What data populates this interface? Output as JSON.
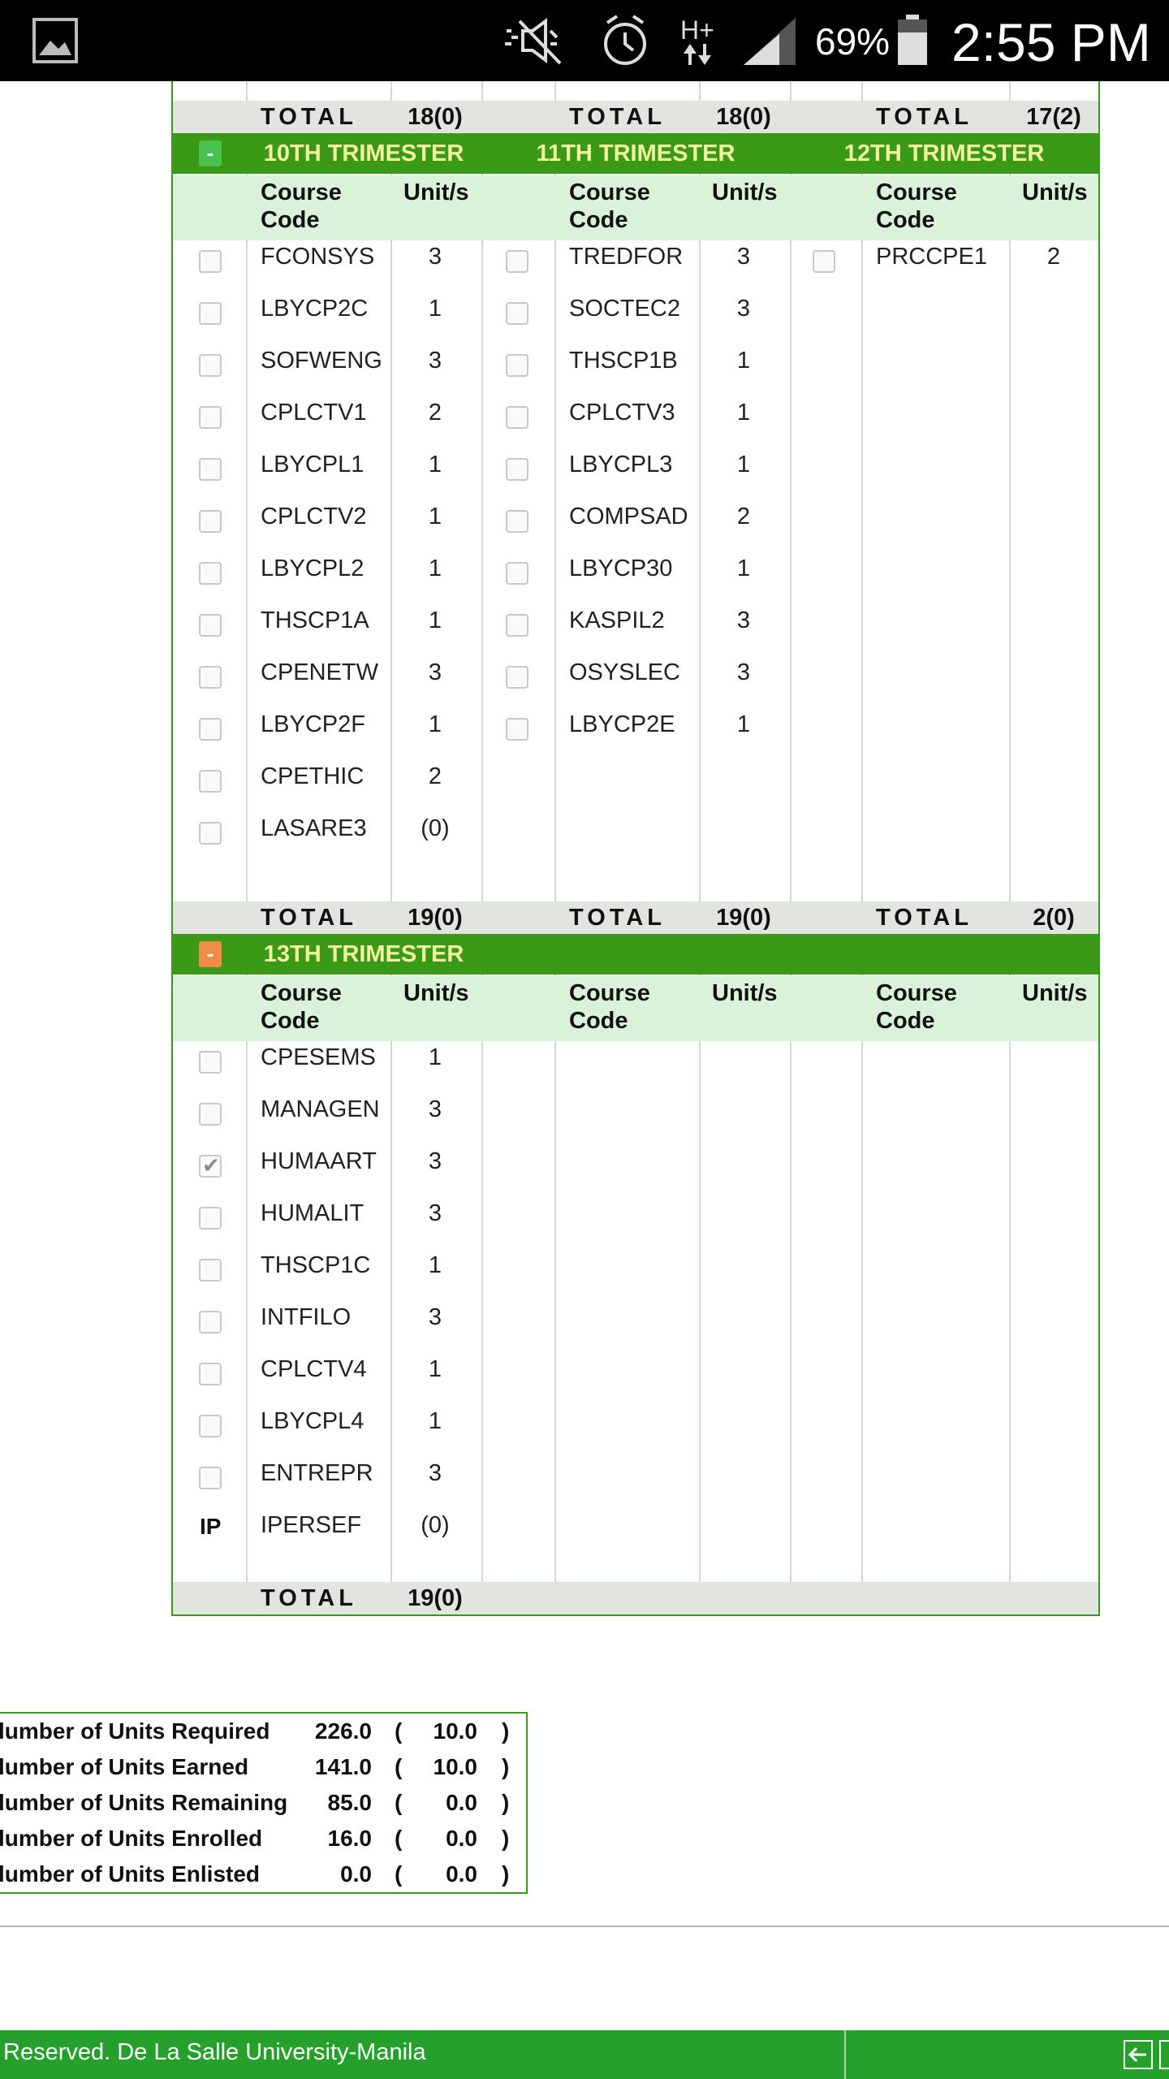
{
  "status_bar": {
    "battery_percent": "69%",
    "time": "2:55 PM",
    "icons": [
      "gallery-icon",
      "mute-icon",
      "alarm-icon",
      "hplus-data-icon",
      "signal-icon",
      "battery-icon"
    ]
  },
  "curriculum": {
    "headers": {
      "course_code": "Course\nCode",
      "units": "Unit/s"
    },
    "total_label": "TOTAL",
    "top_totals": [
      "18(0)",
      "18(0)",
      "17(2)"
    ],
    "block1": {
      "toggle": "-",
      "titles": [
        "10TH TRIMESTER",
        "11TH TRIMESTER",
        "12TH TRIMESTER"
      ],
      "col1": [
        {
          "code": "FCONSYS",
          "units": "3"
        },
        {
          "code": "LBYCP2C",
          "units": "1"
        },
        {
          "code": "SOFWENG",
          "units": "3"
        },
        {
          "code": "CPLCTV1",
          "units": "2"
        },
        {
          "code": "LBYCPL1",
          "units": "1"
        },
        {
          "code": "CPLCTV2",
          "units": "1"
        },
        {
          "code": "LBYCPL2",
          "units": "1"
        },
        {
          "code": "THSCP1A",
          "units": "1"
        },
        {
          "code": "CPENETW",
          "units": "3"
        },
        {
          "code": "LBYCP2F",
          "units": "1"
        },
        {
          "code": "CPETHIC",
          "units": "2"
        },
        {
          "code": "LASARE3",
          "units": "(0)"
        }
      ],
      "col2": [
        {
          "code": "TREDFOR",
          "units": "3"
        },
        {
          "code": "SOCTEC2",
          "units": "3"
        },
        {
          "code": "THSCP1B",
          "units": "1"
        },
        {
          "code": "CPLCTV3",
          "units": "1"
        },
        {
          "code": "LBYCPL3",
          "units": "1"
        },
        {
          "code": "COMPSAD",
          "units": "2"
        },
        {
          "code": "LBYCP30",
          "units": "1"
        },
        {
          "code": "KASPIL2",
          "units": "3"
        },
        {
          "code": "OSYSLEC",
          "units": "3"
        },
        {
          "code": "LBYCP2E",
          "units": "1"
        }
      ],
      "col3": [
        {
          "code": "PRCCPE1",
          "units": "2"
        }
      ],
      "totals": [
        "19(0)",
        "19(0)",
        "2(0)"
      ]
    },
    "block2": {
      "toggle": "-",
      "titles": [
        "13TH TRIMESTER"
      ],
      "col1": [
        {
          "code": "CPESEMS",
          "units": "1",
          "status": "unchecked"
        },
        {
          "code": "MANAGEN",
          "units": "3",
          "status": "unchecked"
        },
        {
          "code": "HUMAART",
          "units": "3",
          "status": "checked"
        },
        {
          "code": "HUMALIT",
          "units": "3",
          "status": "unchecked"
        },
        {
          "code": "THSCP1C",
          "units": "1",
          "status": "unchecked"
        },
        {
          "code": "INTFILO",
          "units": "3",
          "status": "unchecked"
        },
        {
          "code": "CPLCTV4",
          "units": "1",
          "status": "unchecked"
        },
        {
          "code": "LBYCPL4",
          "units": "1",
          "status": "unchecked"
        },
        {
          "code": "ENTREPR",
          "units": "3",
          "status": "unchecked"
        },
        {
          "code": "IPERSEF",
          "units": "(0)",
          "status": "IP"
        }
      ],
      "totals": [
        "19(0)"
      ]
    }
  },
  "summary": [
    {
      "label": "lumber of Units Required",
      "value": "226.0",
      "paren": "10.0"
    },
    {
      "label": "lumber of Units Earned",
      "value": "141.0",
      "paren": "10.0"
    },
    {
      "label": "lumber of Units Remaining",
      "value": "85.0",
      "paren": "0.0"
    },
    {
      "label": "lumber of Units Enrolled",
      "value": "16.0",
      "paren": "0.0"
    },
    {
      "label": "lumber of Units Enlisted",
      "value": "0.0",
      "paren": "0.0"
    }
  ],
  "summary_open": "(",
  "summary_close": ")",
  "footer": {
    "text": "Reserved. De La Salle University-Manila"
  },
  "colors": {
    "green_bar": "#3a9a17",
    "title_text": "#f4f3a0",
    "header_bg": "#d9f2d9",
    "total_bg": "#e2e4df",
    "footer_bg": "#25a02a",
    "toggle_green": "#47c24a",
    "toggle_orange": "#f08b4a"
  }
}
